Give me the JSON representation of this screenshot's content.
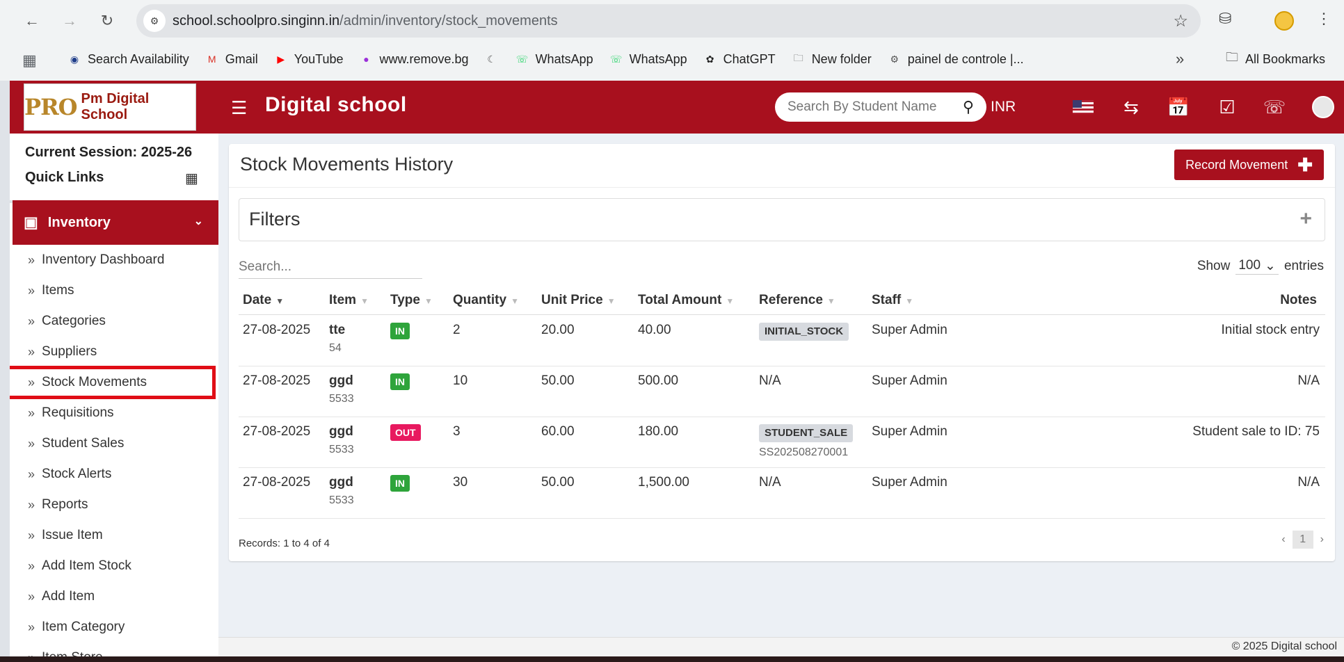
{
  "browser": {
    "url_host": "school.schoolpro.singinn.in",
    "url_path": "/admin/inventory/stock_movements",
    "bookmarks": [
      {
        "label": "Search Availability",
        "icon": "irctc-icon",
        "color": "#1f3d8a"
      },
      {
        "label": "Gmail",
        "icon": "gmail-icon",
        "color": "#d93025"
      },
      {
        "label": "YouTube",
        "icon": "youtube-icon",
        "color": "#ff0000"
      },
      {
        "label": "www.remove.bg",
        "icon": "removebg-icon",
        "color": "#9b30d9"
      },
      {
        "label": "",
        "icon": "moon-icon",
        "color": "#555555"
      },
      {
        "label": "WhatsApp",
        "icon": "whatsapp-icon",
        "color": "#25d366"
      },
      {
        "label": "WhatsApp",
        "icon": "whatsapp-icon",
        "color": "#25d366"
      },
      {
        "label": "ChatGPT",
        "icon": "chatgpt-icon",
        "color": "#222222"
      },
      {
        "label": "New folder",
        "icon": "folder-icon",
        "color": "#555555"
      },
      {
        "label": "painel de controle |...",
        "icon": "panel-icon",
        "color": "#555555"
      }
    ],
    "all_bookmarks": "All Bookmarks"
  },
  "app": {
    "logo_pro": "PRO",
    "logo_name": "Pm Digital School",
    "title": "Digital school",
    "search_placeholder": "Search By Student Name",
    "currency": "INR",
    "brand_color": "#a8101e"
  },
  "sidebar": {
    "session": "Current Session: 2025-26",
    "quick_links": "Quick Links",
    "section": "Inventory",
    "items": [
      "Inventory Dashboard",
      "Items",
      "Categories",
      "Suppliers",
      "Stock Movements",
      "Requisitions",
      "Student Sales",
      "Stock Alerts",
      "Reports",
      "Issue Item",
      "Add Item Stock",
      "Add Item",
      "Item Category",
      "Item Store"
    ]
  },
  "main": {
    "title": "Stock Movements History",
    "record_button": "Record Movement",
    "filters_label": "Filters",
    "search_placeholder": "Search...",
    "show_label": "Show",
    "show_value": "100",
    "entries_label": "entries",
    "columns": [
      "Date",
      "Item",
      "Type",
      "Quantity",
      "Unit Price",
      "Total Amount",
      "Reference",
      "Staff",
      "Notes"
    ],
    "rows": [
      {
        "date": "27-08-2025",
        "item": "tte",
        "item_code": "54",
        "type": "IN",
        "qty": "2",
        "unit_price": "20.00",
        "total": "40.00",
        "ref_tag": "INITIAL_STOCK",
        "ref_sub": "",
        "ref_text": "",
        "staff": "Super Admin",
        "notes": "Initial stock entry"
      },
      {
        "date": "27-08-2025",
        "item": "ggd",
        "item_code": "5533",
        "type": "IN",
        "qty": "10",
        "unit_price": "50.00",
        "total": "500.00",
        "ref_tag": "",
        "ref_sub": "",
        "ref_text": "N/A",
        "staff": "Super Admin",
        "notes": "N/A"
      },
      {
        "date": "27-08-2025",
        "item": "ggd",
        "item_code": "5533",
        "type": "OUT",
        "qty": "3",
        "unit_price": "60.00",
        "total": "180.00",
        "ref_tag": "STUDENT_SALE",
        "ref_sub": "SS202508270001",
        "ref_text": "",
        "staff": "Super Admin",
        "notes": "Student sale to ID: 75"
      },
      {
        "date": "27-08-2025",
        "item": "ggd",
        "item_code": "5533",
        "type": "IN",
        "qty": "30",
        "unit_price": "50.00",
        "total": "1,500.00",
        "ref_tag": "",
        "ref_sub": "",
        "ref_text": "N/A",
        "staff": "Super Admin",
        "notes": "N/A"
      }
    ],
    "records_info": "Records: 1 to 4 of 4",
    "current_page": "1"
  },
  "footer": "© 2025 Digital school"
}
